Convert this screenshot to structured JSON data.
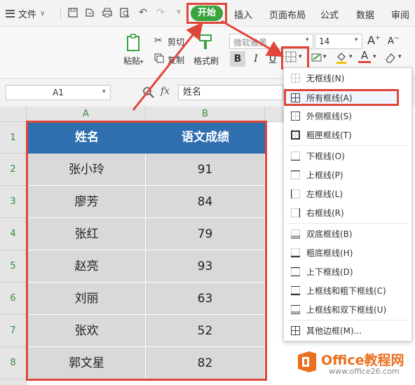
{
  "menubar": {
    "file_label": "文件",
    "tabs": [
      "开始",
      "插入",
      "页面布局",
      "公式",
      "数据",
      "审阅"
    ],
    "active_tab": "开始",
    "active_tab_color": "#3aa33d"
  },
  "ribbon": {
    "paste_label": "粘贴",
    "cut_label": "剪切",
    "copy_label": "复制",
    "format_painter_label": "格式刷",
    "font_name": "微软雅黑",
    "font_size": "14",
    "bold": "B",
    "italic": "I",
    "underline": "U"
  },
  "formula_bar": {
    "cell_ref": "A1",
    "fx_label": "fx",
    "content": "姓名"
  },
  "sheet": {
    "columns": [
      "A",
      "B"
    ],
    "rows": [
      "1",
      "2",
      "3",
      "4",
      "5",
      "6",
      "7",
      "8"
    ],
    "header": [
      "姓名",
      "语文成绩"
    ],
    "data": [
      [
        "张小玲",
        "91"
      ],
      [
        "廖芳",
        "84"
      ],
      [
        "张红",
        "79"
      ],
      [
        "赵亮",
        "93"
      ],
      [
        "刘丽",
        "63"
      ],
      [
        "张欢",
        "52"
      ],
      [
        "郭文星",
        "82"
      ]
    ],
    "header_color": "#2f6fb0",
    "highlight_color": "#e0463a"
  },
  "border_menu": {
    "items": [
      {
        "label": "无框线(N)",
        "icon": "no-border-icon"
      },
      {
        "label": "所有框线(A)",
        "icon": "all-borders-icon"
      },
      {
        "label": "外侧框线(S)",
        "icon": "outside-borders-icon"
      },
      {
        "label": "粗匣框线(T)",
        "icon": "thick-box-border-icon"
      },
      {
        "label": "下框线(O)",
        "icon": "bottom-border-icon"
      },
      {
        "label": "上框线(P)",
        "icon": "top-border-icon"
      },
      {
        "label": "左框线(L)",
        "icon": "left-border-icon"
      },
      {
        "label": "右框线(R)",
        "icon": "right-border-icon"
      },
      {
        "label": "双底框线(B)",
        "icon": "double-bottom-border-icon"
      },
      {
        "label": "粗底框线(H)",
        "icon": "thick-bottom-border-icon"
      },
      {
        "label": "上下框线(D)",
        "icon": "top-bottom-border-icon"
      },
      {
        "label": "上框线和粗下框线(C)",
        "icon": "top-thick-bottom-border-icon"
      },
      {
        "label": "上框线和双下框线(U)",
        "icon": "top-double-bottom-border-icon"
      },
      {
        "label": "其他边框(M)...",
        "icon": "more-borders-icon"
      }
    ],
    "selected": "所有框线(A)"
  },
  "watermark": {
    "brand": "Office教程网",
    "url": "www.office26.com"
  }
}
